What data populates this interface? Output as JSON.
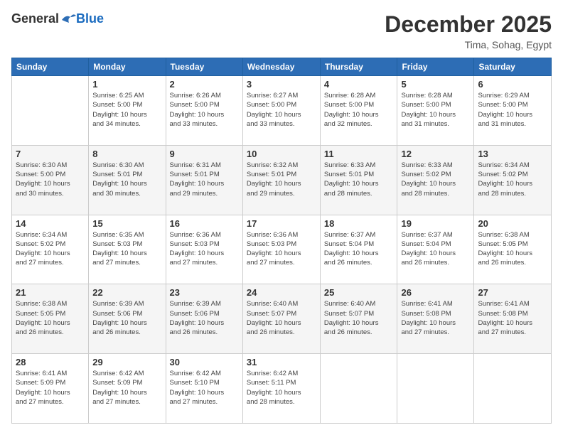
{
  "logo": {
    "general": "General",
    "blue": "Blue"
  },
  "header": {
    "month_title": "December 2025",
    "subtitle": "Tima, Sohag, Egypt"
  },
  "days_of_week": [
    "Sunday",
    "Monday",
    "Tuesday",
    "Wednesday",
    "Thursday",
    "Friday",
    "Saturday"
  ],
  "weeks": [
    [
      {
        "day": "",
        "info": ""
      },
      {
        "day": "1",
        "info": "Sunrise: 6:25 AM\nSunset: 5:00 PM\nDaylight: 10 hours\nand 34 minutes."
      },
      {
        "day": "2",
        "info": "Sunrise: 6:26 AM\nSunset: 5:00 PM\nDaylight: 10 hours\nand 33 minutes."
      },
      {
        "day": "3",
        "info": "Sunrise: 6:27 AM\nSunset: 5:00 PM\nDaylight: 10 hours\nand 33 minutes."
      },
      {
        "day": "4",
        "info": "Sunrise: 6:28 AM\nSunset: 5:00 PM\nDaylight: 10 hours\nand 32 minutes."
      },
      {
        "day": "5",
        "info": "Sunrise: 6:28 AM\nSunset: 5:00 PM\nDaylight: 10 hours\nand 31 minutes."
      },
      {
        "day": "6",
        "info": "Sunrise: 6:29 AM\nSunset: 5:00 PM\nDaylight: 10 hours\nand 31 minutes."
      }
    ],
    [
      {
        "day": "7",
        "info": "Sunrise: 6:30 AM\nSunset: 5:00 PM\nDaylight: 10 hours\nand 30 minutes."
      },
      {
        "day": "8",
        "info": "Sunrise: 6:30 AM\nSunset: 5:01 PM\nDaylight: 10 hours\nand 30 minutes."
      },
      {
        "day": "9",
        "info": "Sunrise: 6:31 AM\nSunset: 5:01 PM\nDaylight: 10 hours\nand 29 minutes."
      },
      {
        "day": "10",
        "info": "Sunrise: 6:32 AM\nSunset: 5:01 PM\nDaylight: 10 hours\nand 29 minutes."
      },
      {
        "day": "11",
        "info": "Sunrise: 6:33 AM\nSunset: 5:01 PM\nDaylight: 10 hours\nand 28 minutes."
      },
      {
        "day": "12",
        "info": "Sunrise: 6:33 AM\nSunset: 5:02 PM\nDaylight: 10 hours\nand 28 minutes."
      },
      {
        "day": "13",
        "info": "Sunrise: 6:34 AM\nSunset: 5:02 PM\nDaylight: 10 hours\nand 28 minutes."
      }
    ],
    [
      {
        "day": "14",
        "info": "Sunrise: 6:34 AM\nSunset: 5:02 PM\nDaylight: 10 hours\nand 27 minutes."
      },
      {
        "day": "15",
        "info": "Sunrise: 6:35 AM\nSunset: 5:03 PM\nDaylight: 10 hours\nand 27 minutes."
      },
      {
        "day": "16",
        "info": "Sunrise: 6:36 AM\nSunset: 5:03 PM\nDaylight: 10 hours\nand 27 minutes."
      },
      {
        "day": "17",
        "info": "Sunrise: 6:36 AM\nSunset: 5:03 PM\nDaylight: 10 hours\nand 27 minutes."
      },
      {
        "day": "18",
        "info": "Sunrise: 6:37 AM\nSunset: 5:04 PM\nDaylight: 10 hours\nand 26 minutes."
      },
      {
        "day": "19",
        "info": "Sunrise: 6:37 AM\nSunset: 5:04 PM\nDaylight: 10 hours\nand 26 minutes."
      },
      {
        "day": "20",
        "info": "Sunrise: 6:38 AM\nSunset: 5:05 PM\nDaylight: 10 hours\nand 26 minutes."
      }
    ],
    [
      {
        "day": "21",
        "info": "Sunrise: 6:38 AM\nSunset: 5:05 PM\nDaylight: 10 hours\nand 26 minutes."
      },
      {
        "day": "22",
        "info": "Sunrise: 6:39 AM\nSunset: 5:06 PM\nDaylight: 10 hours\nand 26 minutes."
      },
      {
        "day": "23",
        "info": "Sunrise: 6:39 AM\nSunset: 5:06 PM\nDaylight: 10 hours\nand 26 minutes."
      },
      {
        "day": "24",
        "info": "Sunrise: 6:40 AM\nSunset: 5:07 PM\nDaylight: 10 hours\nand 26 minutes."
      },
      {
        "day": "25",
        "info": "Sunrise: 6:40 AM\nSunset: 5:07 PM\nDaylight: 10 hours\nand 26 minutes."
      },
      {
        "day": "26",
        "info": "Sunrise: 6:41 AM\nSunset: 5:08 PM\nDaylight: 10 hours\nand 27 minutes."
      },
      {
        "day": "27",
        "info": "Sunrise: 6:41 AM\nSunset: 5:08 PM\nDaylight: 10 hours\nand 27 minutes."
      }
    ],
    [
      {
        "day": "28",
        "info": "Sunrise: 6:41 AM\nSunset: 5:09 PM\nDaylight: 10 hours\nand 27 minutes."
      },
      {
        "day": "29",
        "info": "Sunrise: 6:42 AM\nSunset: 5:09 PM\nDaylight: 10 hours\nand 27 minutes."
      },
      {
        "day": "30",
        "info": "Sunrise: 6:42 AM\nSunset: 5:10 PM\nDaylight: 10 hours\nand 27 minutes."
      },
      {
        "day": "31",
        "info": "Sunrise: 6:42 AM\nSunset: 5:11 PM\nDaylight: 10 hours\nand 28 minutes."
      },
      {
        "day": "",
        "info": ""
      },
      {
        "day": "",
        "info": ""
      },
      {
        "day": "",
        "info": ""
      }
    ]
  ]
}
